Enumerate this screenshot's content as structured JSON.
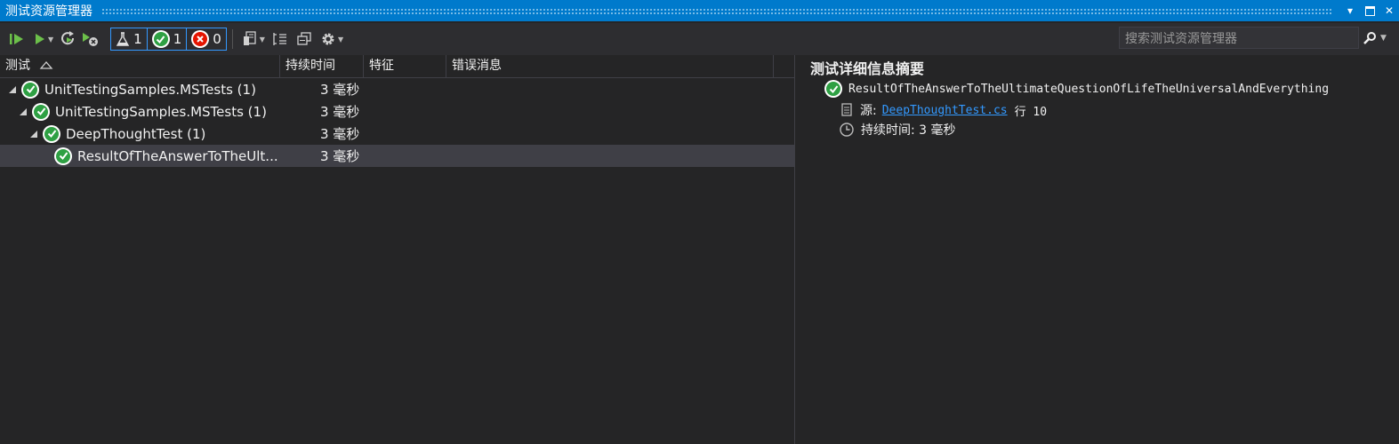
{
  "window": {
    "title": "测试资源管理器"
  },
  "toolbar": {
    "filter_all_count": "1",
    "filter_passed_count": "1",
    "filter_failed_count": "0"
  },
  "search": {
    "placeholder": "搜索测试资源管理器"
  },
  "columns": {
    "test": "测试",
    "duration": "持续时间",
    "traits": "特征",
    "error": "错误消息"
  },
  "tree": [
    {
      "name": "UnitTestingSamples.MSTests (1)",
      "duration": "3 毫秒"
    },
    {
      "name": "UnitTestingSamples.MSTests (1)",
      "duration": "3 毫秒"
    },
    {
      "name": "DeepThoughtTest (1)",
      "duration": "3 毫秒"
    },
    {
      "name": "ResultOfTheAnswerToTheUlt...",
      "duration": "3 毫秒"
    }
  ],
  "details": {
    "title": "测试详细信息摘要",
    "test_name": "ResultOfTheAnswerToTheUltimateQuestionOfLifeTheUniversalAndEverything",
    "source_label": "源:",
    "source_file": "DeepThoughtTest.cs",
    "line_label": "行 10",
    "duration_label": "持续时间: 3 毫秒"
  },
  "colors": {
    "accent": "#007acc",
    "pass": "#2ea043",
    "fail": "#e51400",
    "link": "#3399ff"
  }
}
